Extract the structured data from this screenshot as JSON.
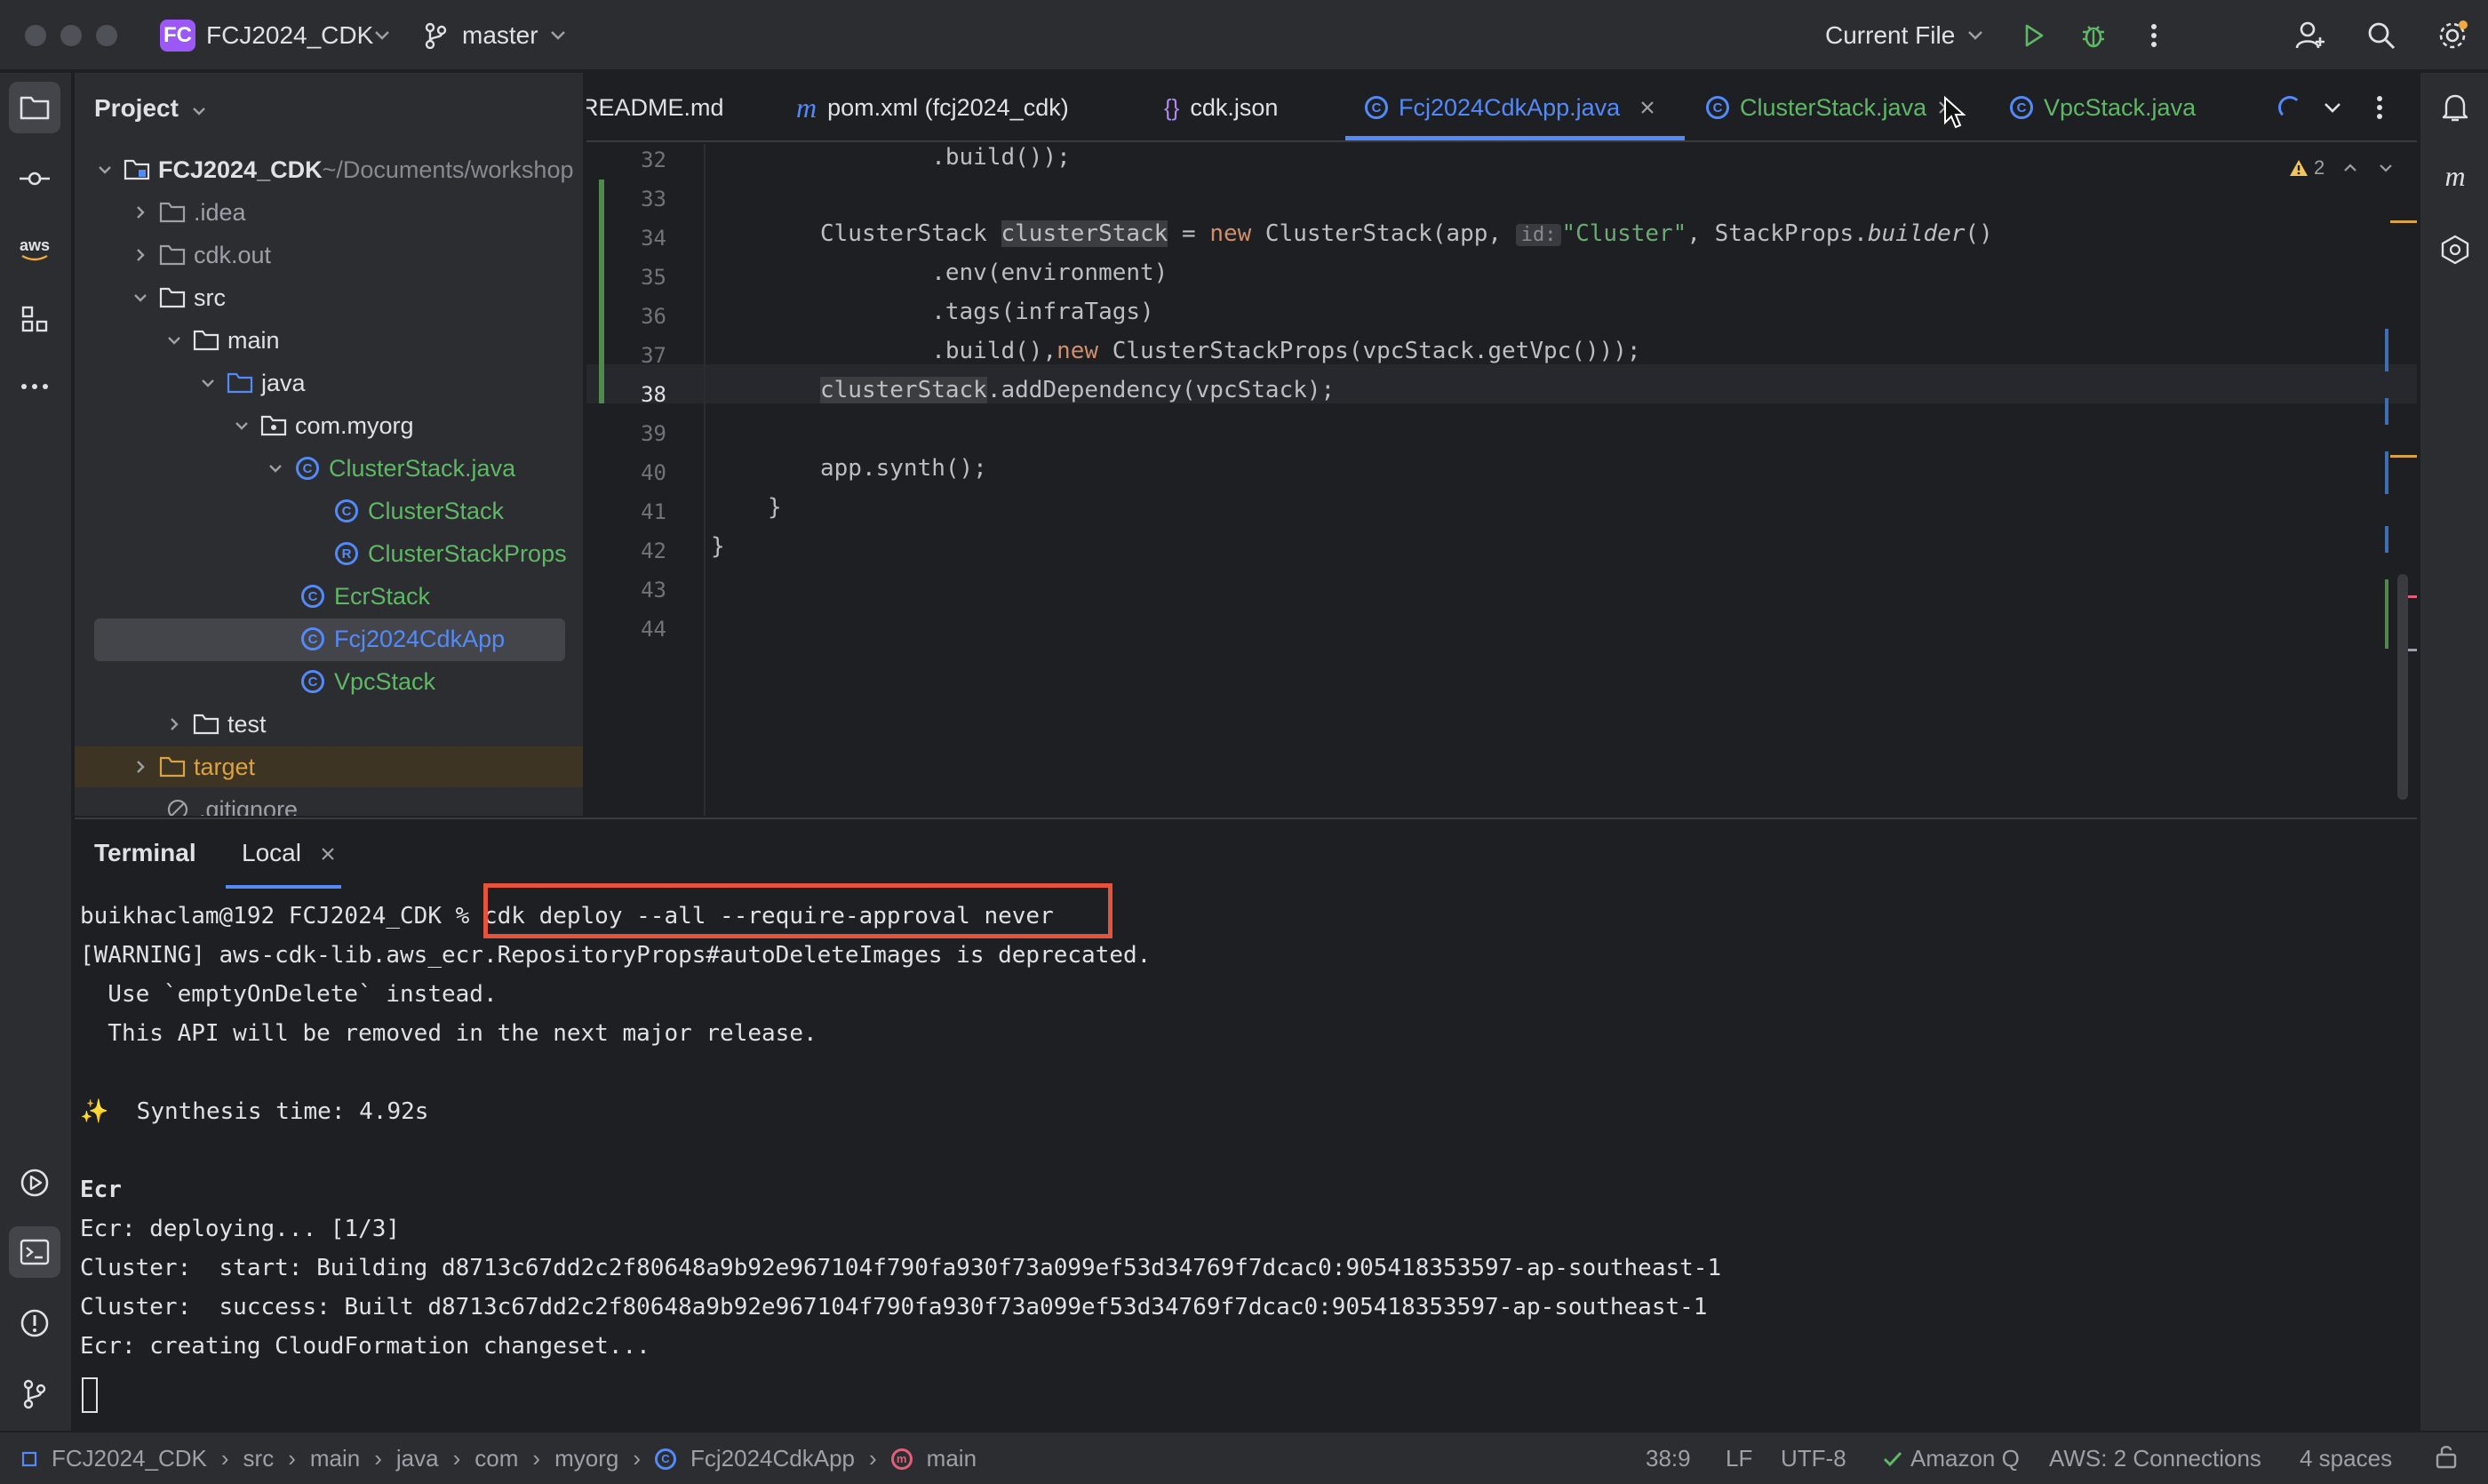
{
  "window": {
    "project_badge": "FC",
    "project_name": "FCJ2024_CDK",
    "branch": "master",
    "run_config": "Current File"
  },
  "project_panel": {
    "title": "Project",
    "tree": [
      {
        "label": "FCJ2024_CDK",
        "suffix": " ~/Documents/workshop"
      },
      {
        "label": ".idea"
      },
      {
        "label": "cdk.out"
      },
      {
        "label": "src"
      },
      {
        "label": "main"
      },
      {
        "label": "java"
      },
      {
        "label": "com.myorg"
      },
      {
        "label": "ClusterStack.java"
      },
      {
        "label": "ClusterStack"
      },
      {
        "label": "ClusterStackProps"
      },
      {
        "label": "EcrStack"
      },
      {
        "label": "Fcj2024CdkApp"
      },
      {
        "label": "VpcStack"
      },
      {
        "label": "test"
      },
      {
        "label": "target"
      },
      {
        "label": ".gitignore"
      }
    ]
  },
  "tabs": [
    {
      "label": "README.md"
    },
    {
      "label": "pom.xml (fcj2024_cdk)"
    },
    {
      "label": "cdk.json"
    },
    {
      "label": "Fcj2024CdkApp.java"
    },
    {
      "label": "ClusterStack.java"
    },
    {
      "label": "VpcStack.java"
    }
  ],
  "editor": {
    "warning_count": "2",
    "line_numbers": [
      "32",
      "33",
      "34",
      "35",
      "36",
      "37",
      "38",
      "39",
      "40",
      "41",
      "42",
      "43",
      "44"
    ],
    "code": {
      "l32": "        .build());",
      "l34_a": "ClusterStack ",
      "l34_var": "clusterStack",
      "l34_b": " = ",
      "l34_new": "new",
      "l34_c": " ClusterStack(app, ",
      "l34_hint": "id:",
      "l34_str": "\"Cluster\"",
      "l34_d": ", StackProps.",
      "l34_builder": "builder",
      "l34_e": "()",
      "l35": "        .env(environment)",
      "l36": "        .tags(infraTags)",
      "l37_a": "        .build(),",
      "l37_new": "new",
      "l37_b": " ClusterStackProps(vpcStack.getVpc()));",
      "l38_var": "clusterStack",
      "l38_rest": ".addDependency(vpcStack);",
      "l40": "app.synth();",
      "l41": "}",
      "l42": "}"
    }
  },
  "terminal": {
    "title": "Terminal",
    "tab": "Local",
    "prompt": "buikhaclam@192 FCJ2024_CDK % ",
    "command": "cdk deploy --all --require-approval never",
    "lines": [
      "[WARNING] aws-cdk-lib.aws_ecr.RepositoryProps#autoDeleteImages is deprecated.",
      "  Use `emptyOnDelete` instead.",
      "  This API will be removed in the next major release.",
      "",
      "✨  Synthesis time: 4.92s",
      "",
      "Ecr",
      "Ecr: deploying... [1/3]",
      "Cluster:  start: Building d8713c67dd2c2f80648a9b92e967104f790fa930f73a099ef53d34769f7dcac0:905418353597-ap-southeast-1",
      "Cluster:  success: Built d8713c67dd2c2f80648a9b92e967104f790fa930f73a099ef53d34769f7dcac0:905418353597-ap-southeast-1",
      "Ecr: creating CloudFormation changeset..."
    ]
  },
  "statusbar": {
    "breadcrumb": [
      "FCJ2024_CDK",
      "src",
      "main",
      "java",
      "com",
      "myorg",
      "Fcj2024CdkApp",
      "main"
    ],
    "position": "38:9",
    "line_ending": "LF",
    "encoding": "UTF-8",
    "amazon_q": "Amazon Q",
    "aws": "AWS: 2 Connections",
    "indent": "4 spaces"
  },
  "icons": {
    "aws_label": "aws",
    "amazon_q_label": "m"
  },
  "colors": {
    "accent": "#548af7",
    "highlight_box": "#e6533a",
    "string": "#6aab73",
    "keyword": "#cf8e6d",
    "modified_file": "#5fb865",
    "excluded_folder": "#d9a343"
  }
}
